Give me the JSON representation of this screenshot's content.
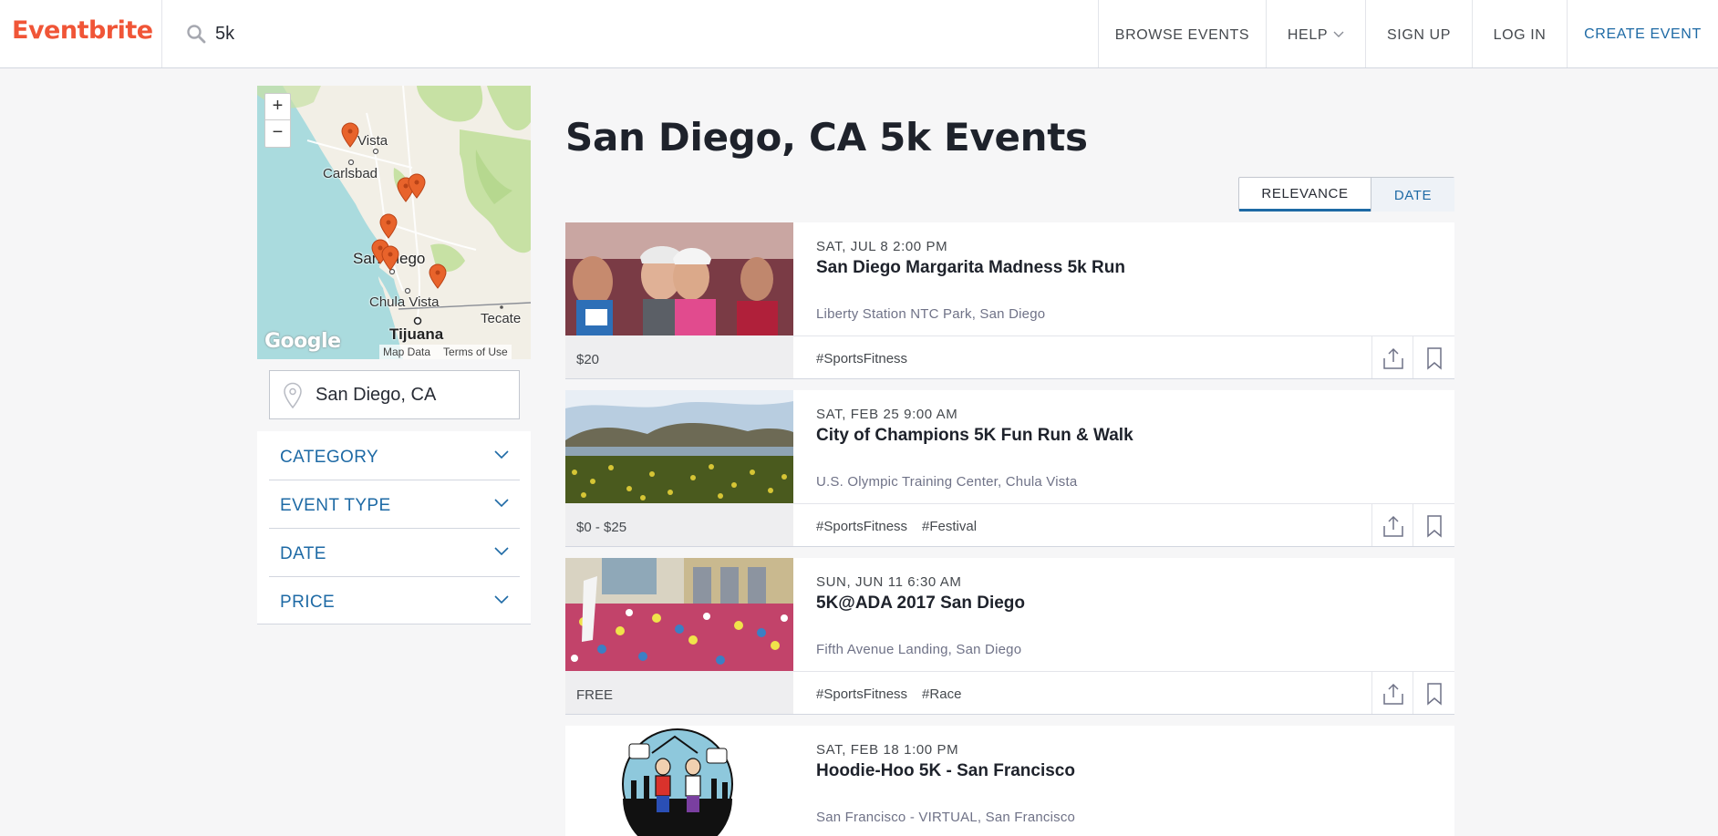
{
  "header": {
    "logo": "Eventbrite",
    "search_value": "5k",
    "nav": {
      "browse": "BROWSE EVENTS",
      "help": "HELP",
      "signup": "SIGN UP",
      "login": "LOG IN",
      "create": "CREATE EVENT"
    }
  },
  "map": {
    "zoom_in": "+",
    "zoom_out": "−",
    "places": {
      "vista": "Vista",
      "carlsbad": "Carlsbad",
      "san_diego": "San Diego",
      "chula_vista": "Chula Vista",
      "tecate": "Tecate",
      "tijuana": "Tijuana"
    },
    "provider_logo": "Google",
    "map_data": "Map Data",
    "terms": "Terms of Use"
  },
  "sidebar": {
    "location_value": "San Diego, CA",
    "filters": [
      "CATEGORY",
      "EVENT TYPE",
      "DATE",
      "PRICE"
    ]
  },
  "page_title": "San Diego, CA 5k Events",
  "sort": {
    "relevance": "RELEVANCE",
    "date": "DATE"
  },
  "events": [
    {
      "date": "SAT, JUL 8 2:00 PM",
      "title": "San Diego Margarita Madness 5k Run",
      "venue": "Liberty Station NTC Park, San Diego",
      "price": "$20",
      "tags": [
        "#SportsFitness"
      ]
    },
    {
      "date": "SAT, FEB 25 9:00 AM",
      "title": "City of Champions 5K Fun Run & Walk",
      "venue": "U.S. Olympic Training Center, Chula Vista",
      "price": "$0 - $25",
      "tags": [
        "#SportsFitness",
        "#Festival"
      ]
    },
    {
      "date": "SUN, JUN 11 6:30 AM",
      "title": "5K@ADA 2017 San Diego",
      "venue": "Fifth Avenue Landing, San Diego",
      "price": "FREE",
      "tags": [
        "#SportsFitness",
        "#Race"
      ]
    },
    {
      "date": "SAT, FEB 18 1:00 PM",
      "title": "Hoodie-Hoo 5K - San Francisco",
      "venue": "San Francisco - VIRTUAL, San Francisco",
      "price": "",
      "tags": []
    }
  ],
  "colors": {
    "brand": "#f05537",
    "link": "#1e6aa5",
    "ocean": "#aadbde",
    "park": "#c7e1a4",
    "pin": "#e8632b"
  }
}
